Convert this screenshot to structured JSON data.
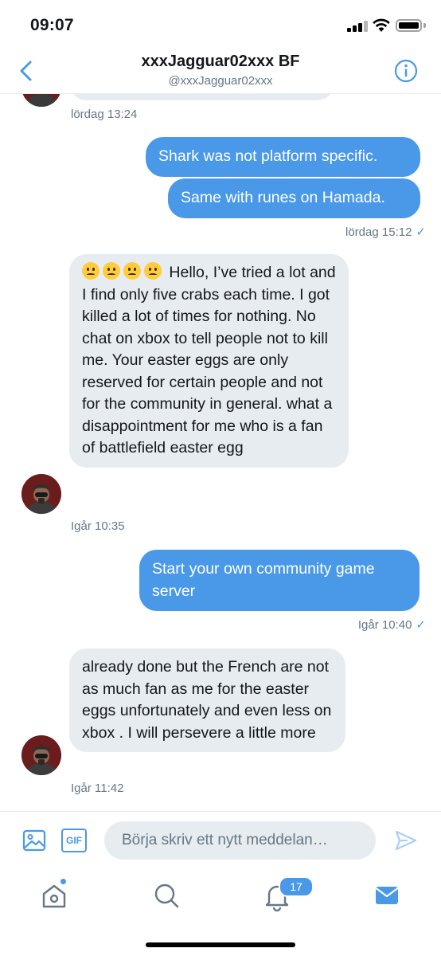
{
  "status_bar": {
    "time": "09:07"
  },
  "header": {
    "title": "xxxJagguar02xxx BF",
    "handle": "@xxxJagguar02xxx",
    "back_icon": "chevron-left-icon",
    "info_icon": "info-icon"
  },
  "messages": [
    {
      "direction": "incoming",
      "text": "",
      "timestamp": "lördag 13:24"
    },
    {
      "direction": "outgoing",
      "text": "Shark was not platform specific."
    },
    {
      "direction": "outgoing",
      "text": "Same with runes on Hamada.",
      "timestamp": "lördag 15:12",
      "read": true
    },
    {
      "direction": "incoming",
      "emojis": [
        "confused-face",
        "confused-face",
        "worried-face",
        "pensive-face"
      ],
      "text": "Hello, I’ve tried a lot and I find only five crabs each time. I got killed a lot of times for nothing. No chat on xbox to tell people not to kill me. Your easter eggs are only reserved for certain people and not for the community in general. what a disappointment for me who is a fan of battlefield easter egg",
      "timestamp": "Igår 10:35"
    },
    {
      "direction": "outgoing",
      "text": "Start your own community game server",
      "timestamp": "Igår 10:40",
      "read": true
    },
    {
      "direction": "incoming",
      "text": "already done but the French are not as much fan as me for the easter eggs unfortunately and even less on xbox . I will persevere a little more",
      "timestamp": "Igår 11:42"
    }
  ],
  "composer": {
    "placeholder": "Börja skriv ett nytt meddelan…",
    "gif_label": "GIF"
  },
  "tab_bar": {
    "notifications_badge": "17"
  },
  "colors": {
    "accent": "#4a99e9",
    "incoming_bubble": "#e6ecf0",
    "secondary_text": "#657786"
  }
}
